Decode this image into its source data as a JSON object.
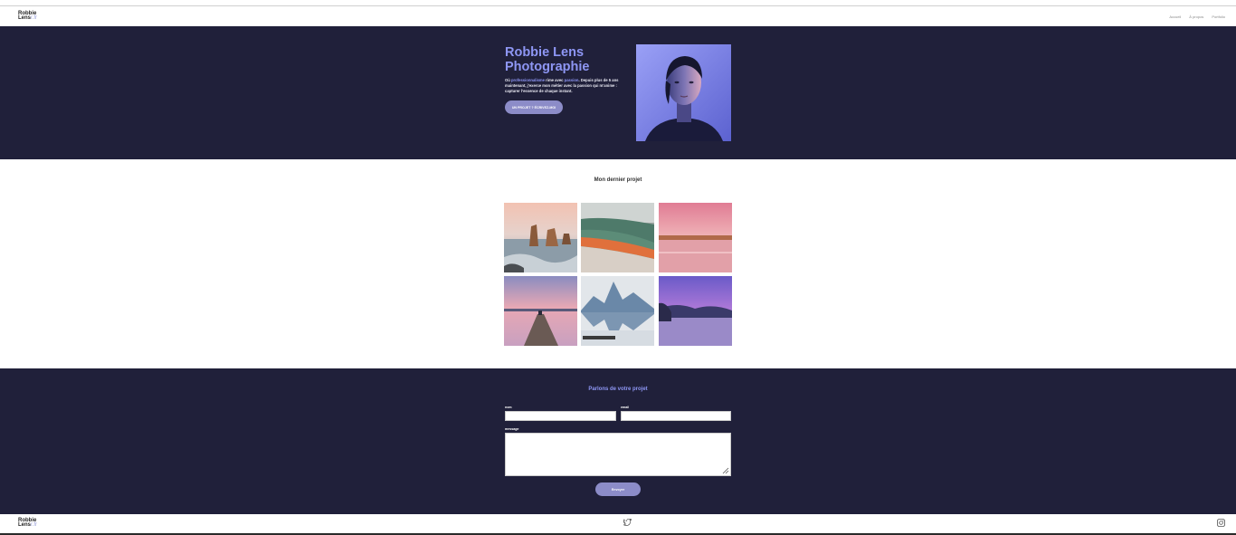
{
  "brand": {
    "line1": "Robbie",
    "line2": "Lens",
    "suffix": "r.fr"
  },
  "nav": {
    "items": [
      {
        "label": "Accueil"
      },
      {
        "label": "À propos"
      },
      {
        "label": "Portfolio"
      }
    ]
  },
  "hero": {
    "title_line1": "Robbie Lens",
    "title_line2": "Photographie",
    "text_part1": "Où ",
    "text_hl1": "professionnalisme",
    "text_part2": " rime avec ",
    "text_hl2": "passion",
    "text_part3": ". Depuis plus de 5 ans maintenant, j'exerce mon métier avec la passion qui m'anime : capturer l'essence de chaque instant.",
    "cta_label": "UN PROJET ? ÉCRIVEZ-MOI",
    "portrait_alt": "portrait photo"
  },
  "project": {
    "title": "Mon dernier projet",
    "photos": [
      {
        "name": "sea-stacks-photo"
      },
      {
        "name": "hot-spring-photo"
      },
      {
        "name": "pink-lake-photo"
      },
      {
        "name": "jetty-sunset-photo"
      },
      {
        "name": "mountain-reflection-photo"
      },
      {
        "name": "purple-lake-photo"
      }
    ]
  },
  "contact": {
    "title": "Parlons de votre projet",
    "name_label": "nom",
    "email_label": "email",
    "message_label": "message",
    "name_value": "",
    "email_value": "",
    "message_value": "",
    "send_label": "Envoyer"
  },
  "footer": {
    "twitter_icon": "twitter-icon",
    "instagram_icon": "instagram-icon"
  },
  "colors": {
    "dark_bg": "#20203a",
    "accent": "#8e96f4",
    "button": "#8c8cc8"
  }
}
